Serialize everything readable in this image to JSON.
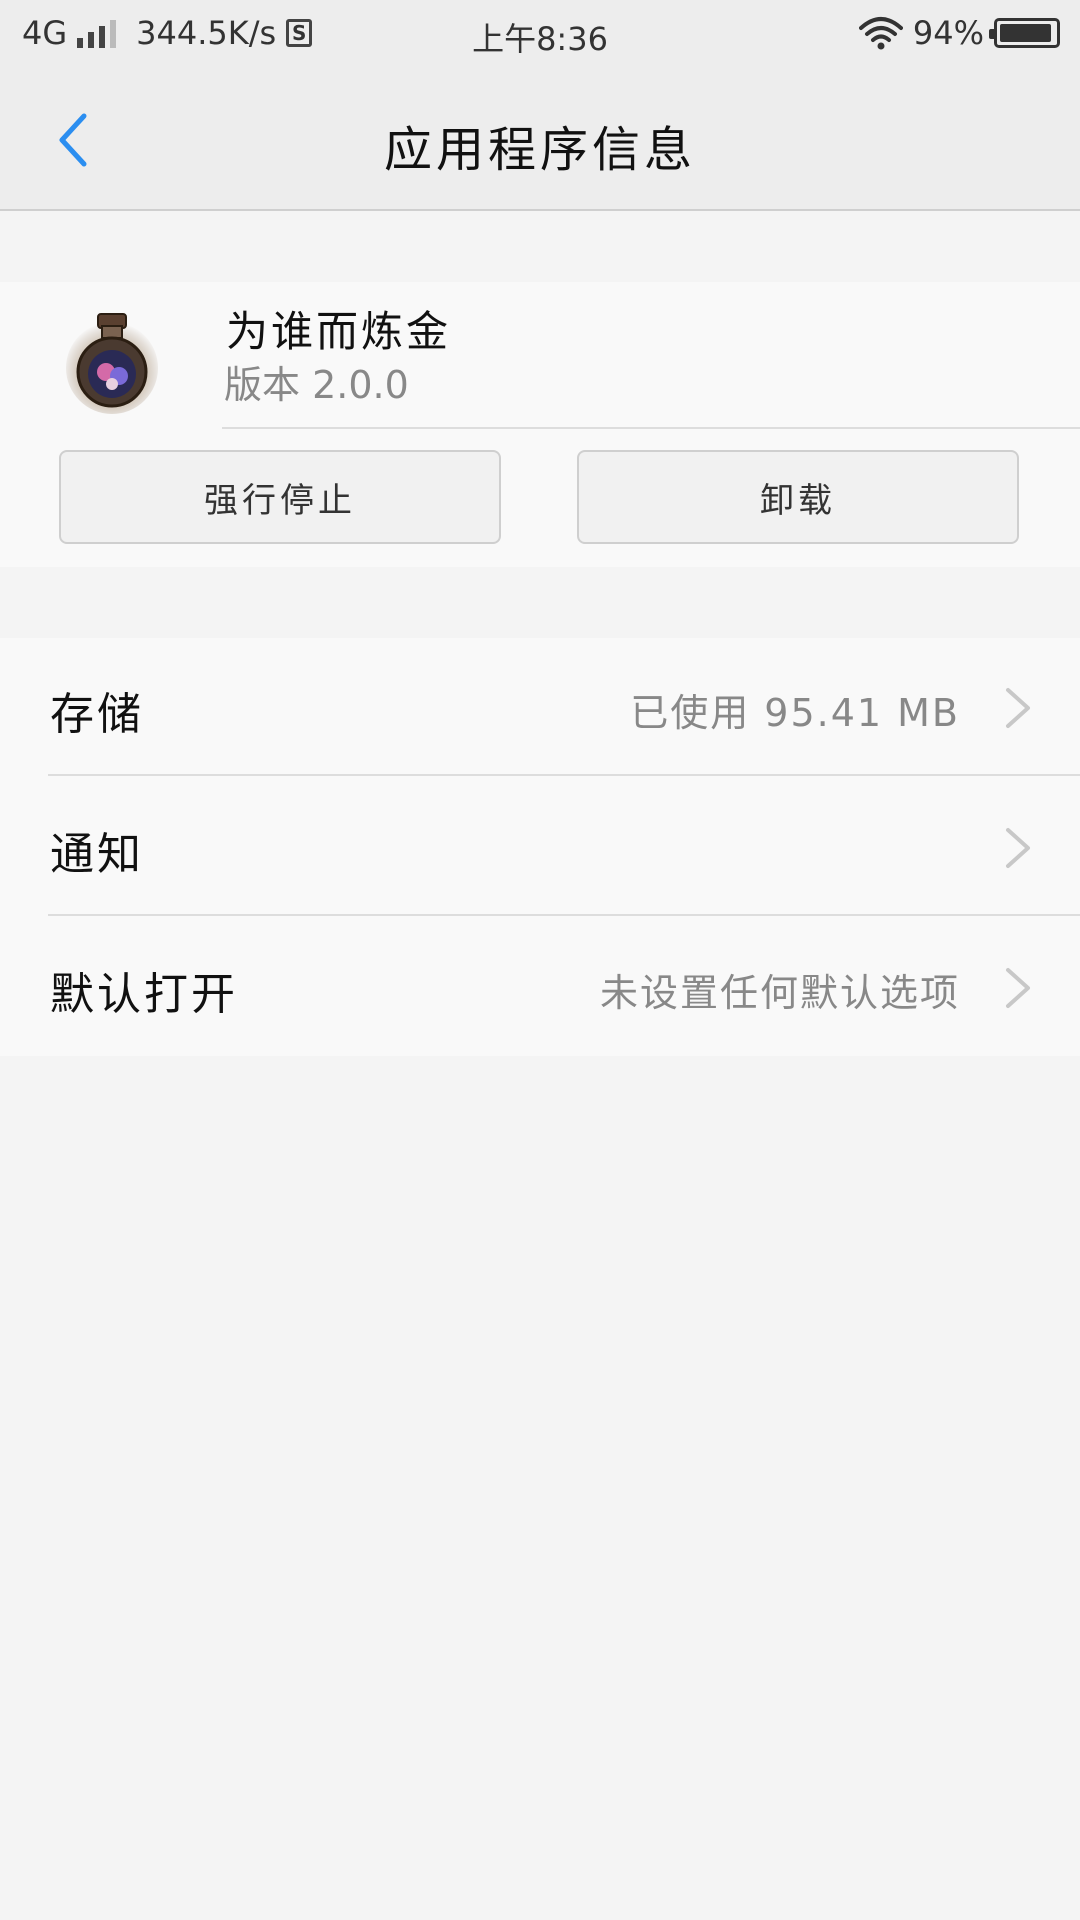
{
  "status_bar": {
    "network": "4G",
    "speed": "344.5K/s",
    "sim_label": "S",
    "time": "上午8:36",
    "battery": "94%",
    "battery_level": 0.94
  },
  "header": {
    "title": "应用程序信息",
    "back_icon": "chevron-left-icon",
    "accent_color": "#2b8ef0"
  },
  "app": {
    "name": "为谁而炼金",
    "version": "版本 2.0.0",
    "icon": "potion-bottle-app-icon"
  },
  "actions": {
    "force_stop_label": "强行停止",
    "uninstall_label": "卸载"
  },
  "settings": [
    {
      "label": "存储",
      "value": "已使用 95.41 MB"
    },
    {
      "label": "通知",
      "value": ""
    },
    {
      "label": "默认打开",
      "value": "未设置任何默认选项"
    }
  ]
}
